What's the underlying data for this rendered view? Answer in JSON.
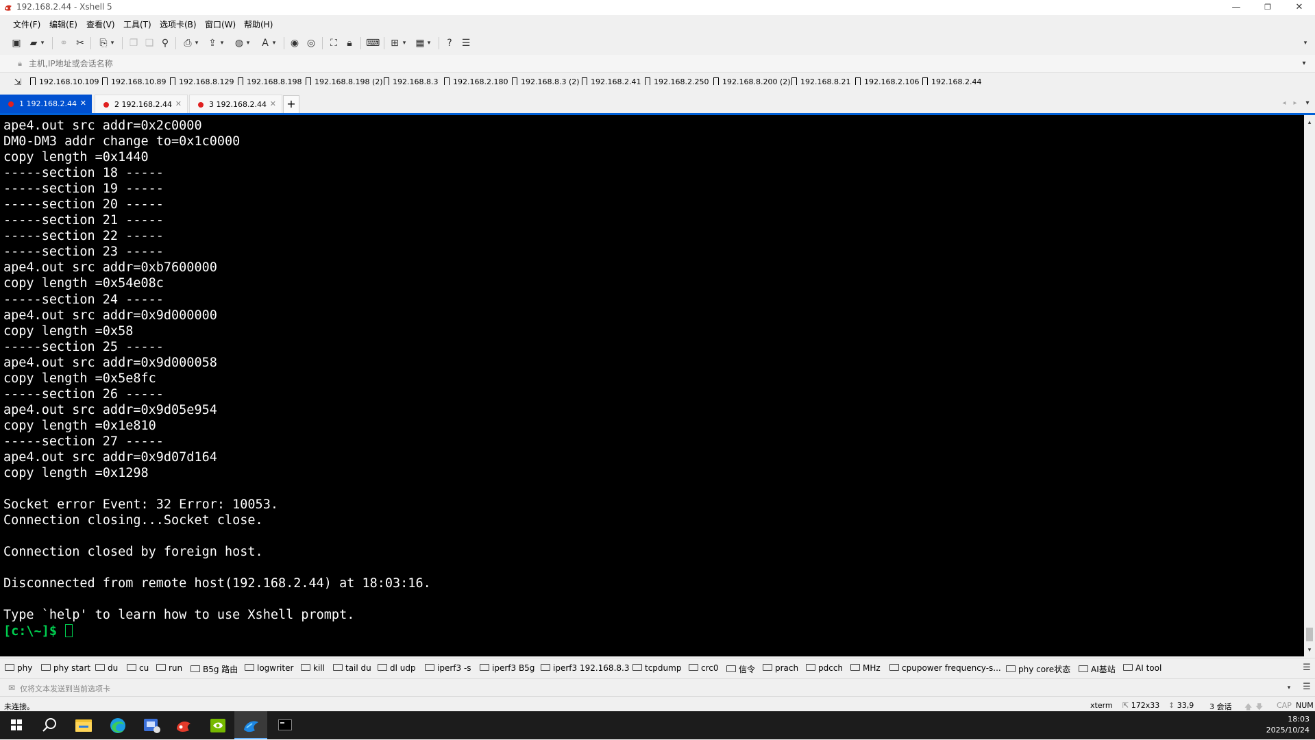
{
  "window": {
    "title": "192.168.2.44 - Xshell 5",
    "controls": {
      "minimize": "—",
      "restore": "❐",
      "close": "✕"
    }
  },
  "menu": [
    "文件(F)",
    "编辑(E)",
    "查看(V)",
    "工具(T)",
    "选项卡(B)",
    "窗口(W)",
    "帮助(H)"
  ],
  "address_bar": {
    "placeholder": "主机,IP地址或会话名称"
  },
  "bookmarks": [
    "192.168.10.109",
    "192.168.10.89",
    "192.168.8.129",
    "192.168.8.198",
    "192.168.8.198 (2)",
    "192.168.8.3",
    "192.168.2.180",
    "192.168.8.3 (2)",
    "192.168.2.41",
    "192.168.2.250",
    "192.168.8.200 (2)",
    "192.168.8.21",
    "192.168.2.106",
    "192.168.2.44"
  ],
  "tabs": [
    {
      "label": "1 192.168.2.44",
      "active": true
    },
    {
      "label": "2 192.168.2.44",
      "active": false
    },
    {
      "label": "3 192.168.2.44",
      "active": false
    }
  ],
  "tab_add": "+",
  "terminal": {
    "lines": [
      "ape4.out src addr=0x2c0000",
      "DM0-DM3 addr change to=0x1c0000",
      "copy length =0x1440",
      "-----section 18 -----",
      "-----section 19 -----",
      "-----section 20 -----",
      "-----section 21 -----",
      "-----section 22 -----",
      "-----section 23 -----",
      "ape4.out src addr=0xb7600000",
      "copy length =0x54e08c",
      "-----section 24 -----",
      "ape4.out src addr=0x9d000000",
      "copy length =0x58",
      "-----section 25 -----",
      "ape4.out src addr=0x9d000058",
      "copy length =0x5e8fc",
      "-----section 26 -----",
      "ape4.out src addr=0x9d05e954",
      "copy length =0x1e810",
      "-----section 27 -----",
      "ape4.out src addr=0x9d07d164",
      "copy length =0x1298",
      "",
      "Socket error Event: 32 Error: 10053.",
      "Connection closing...Socket close.",
      "",
      "Connection closed by foreign host.",
      "",
      "Disconnected from remote host(192.168.2.44) at 18:03:16.",
      "",
      "Type `help' to learn how to use Xshell prompt."
    ],
    "prompt": "[c:\\~]$ "
  },
  "quick_commands": [
    "phy",
    "phy start",
    "du",
    "cu",
    "run",
    "B5g 路由",
    "logwriter",
    "kill",
    "tail du",
    "dl udp",
    "iperf3 -s",
    "iperf3 B5g",
    "iperf3 192.168.8.3",
    "tcpdump",
    "crc0",
    "信令",
    "prach",
    "pdcch",
    "MHz",
    "cpupower frequency-s...",
    "phy core状态",
    "AI基站",
    "AI tool"
  ],
  "compose": {
    "hint": "仅将文本发送到当前选项卡"
  },
  "status": {
    "connection": "未连接。",
    "term": "xterm",
    "size": "172x33",
    "position": "33,9",
    "sessions": "3 会话",
    "cap": "CAP",
    "num": "NUM"
  },
  "taskbar": {
    "time": "18:03",
    "date": "2025/10/24"
  },
  "colors": {
    "accent": "#0060d8",
    "terminal_bg": "#000000",
    "terminal_fg": "#ffffff",
    "prompt": "#00d050",
    "tab_dot": "#e02020"
  }
}
